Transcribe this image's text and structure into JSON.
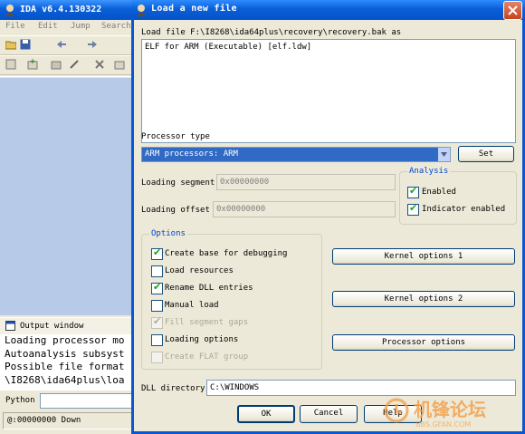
{
  "ida": {
    "title": "IDA v6.4.130322",
    "menu": [
      "File",
      "Edit",
      "Jump",
      "Search"
    ],
    "output_window_label": "Output window",
    "output_lines": [
      "Loading processor mo",
      "Autoanalysis subsyst",
      "Possible file format",
      "\\I8268\\ida64plus\\loa"
    ],
    "python_label": "Python",
    "status_text": "@:00000000 Down"
  },
  "dialog": {
    "title": "Load a new file",
    "load_file_text": "Load file F:\\I8268\\ida64plus\\recovery\\recovery.bak as",
    "formats": [
      "ELF for ARM (Executable) [elf.ldw]"
    ],
    "processor_type_label": "Processor type",
    "processor_selected": "ARM processors: ARM",
    "set_button": "Set",
    "loading_segment_label": "Loading segment",
    "loading_segment_value": "0x00000000",
    "loading_offset_label": "Loading offset",
    "loading_offset_value": "0x00000000",
    "analysis": {
      "title": "Analysis",
      "enabled_label": "Enabled",
      "enabled": true,
      "indicator_label": "Indicator enabled",
      "indicator": true
    },
    "options": {
      "title": "Options",
      "items": [
        {
          "label": "Create base for debugging",
          "checked": true,
          "disabled": false
        },
        {
          "label": "Load resources",
          "checked": false,
          "disabled": false
        },
        {
          "label": "Rename DLL entries",
          "checked": true,
          "disabled": false
        },
        {
          "label": "Manual load",
          "checked": false,
          "disabled": false
        },
        {
          "label": "Fill segment gaps",
          "checked": true,
          "disabled": true
        },
        {
          "label": "Loading options",
          "checked": false,
          "disabled": false
        },
        {
          "label": "Create FLAT group",
          "checked": false,
          "disabled": true
        }
      ]
    },
    "kernel_options_1": "Kernel options 1",
    "kernel_options_2": "Kernel options 2",
    "processor_options": "Processor options",
    "dll_directory_label": "DLL directory",
    "dll_directory_value": "C:\\WINDOWS",
    "ok_button": "OK",
    "cancel_button": "Cancel",
    "help_button": "Help"
  },
  "watermark": {
    "brand": "机锋论坛",
    "url": "BBS.GFAN.COM"
  },
  "colors": {
    "title_blue": "#0a5fd8",
    "group_title": "#0046d5",
    "selection": "#316ac5",
    "check_green": "#21a121"
  }
}
